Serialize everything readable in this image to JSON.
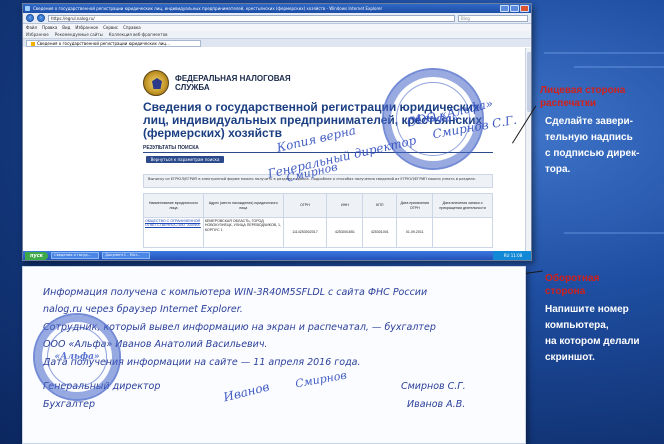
{
  "window": {
    "title": "Сведения о государственной регистрации юридических лиц, индивидуальных предпринимателей, крестьянских (фермерских) хозяйств - Windows Internet Explorer",
    "address": "https://egrul.nalog.ru/",
    "search_placeholder": "Bing",
    "menu": [
      "Файл",
      "Правка",
      "Вид",
      "Избранное",
      "Сервис",
      "Справка"
    ],
    "favorites": [
      "Избранное",
      "Рекомендуемые сайты",
      "Коллекция веб-фрагментов"
    ],
    "tab": "Сведения о государственной регистрации юридических лиц..."
  },
  "page": {
    "org_name": "ФЕДЕРАЛЬНАЯ НАЛОГОВАЯ СЛУЖБА",
    "title": "Сведения о государственной регистрации юридических лиц, индивидуальных предпринимателей, крестьянских (фермерских) хозяйств",
    "results_header": "РЕЗУЛЬТАТЫ ПОИСКА",
    "button_label": "Вернуться к параметрам поиска",
    "notice": "Выписку из ЕГРЮЛ/ЕГРИП в электронной форме можно получить в разделе сервиса. Подробнее о способах получения сведений из ЕГРЮЛ/ЕГРИП можно узнать в разделе.",
    "table": {
      "headers": [
        "Наименование юридического лица",
        "Адрес (место нахождения) юридического лица",
        "ОГРН",
        "ИНН",
        "КПП",
        "Дата присвоения ОГРН",
        "Дата внесения записи о прекращении деятельности"
      ],
      "row": [
        "ОБЩЕСТВО С ОГРАНИЧЕННОЙ ОТВЕТСТВЕННОСТЬЮ \"АЛЬФА\"",
        "КЕМЕРОВСКАЯ ОБЛАСТЬ, ГОРОД НОВОКУЗНЕЦК, УЛИЦА ПЕРЕВОДЧИКОВ, 1, КОРПУС 1",
        "1114253002017",
        "4253001651",
        "425301001",
        "01.09.2011",
        ""
      ]
    }
  },
  "taskbar": {
    "start": "пуск",
    "tasks": [
      "Сведения о госуд...",
      "Документ1 - Micr..."
    ],
    "clock": "RU 11:08"
  },
  "front_stamp": {
    "copy": "Копия верна",
    "company": "«Альфа»",
    "company2": "ООО «Альфа»",
    "position": "Генеральный директор",
    "name": "Смирнов С.Г.",
    "sign": "Смирнов"
  },
  "annotations": {
    "front_title": [
      "Лицевая сторона",
      "распечатки"
    ],
    "front_text": [
      "Сделайте завери-",
      "тельную надпись",
      "с подписью дирек-",
      "тора."
    ],
    "back_title": [
      "Оборотная",
      "сторона"
    ],
    "back_text": [
      "Напишите номер",
      "компьютера,",
      "на котором делали",
      "скриншот."
    ]
  },
  "back": {
    "line1": "Информация получена с компьютера WIN-3R40M5SFLDL с сайта ФНС России",
    "line2": "nalog.ru через браузер Internet Explorer.",
    "line3": "Сотрудник, который вывел информацию на экран и распечатал, — бухгалтер",
    "line4": "ООО «Альфа» Иванов Анатолий Васильевич.",
    "line5": "Дата получения информации на сайте — 11 апреля 2016 года.",
    "role1": "Генеральный директор",
    "role2": "Бухгалтер",
    "name1": "Смирнов С.Г.",
    "name2": "Иванов А.В.",
    "sig1": "Иванов",
    "sig2": "Смирнов",
    "stamp_text": "«Альфа»"
  },
  "colors": {
    "background": "#1f4fa3",
    "accent_red": "#d0201a",
    "stamp_blue": "#2a3f9a"
  }
}
